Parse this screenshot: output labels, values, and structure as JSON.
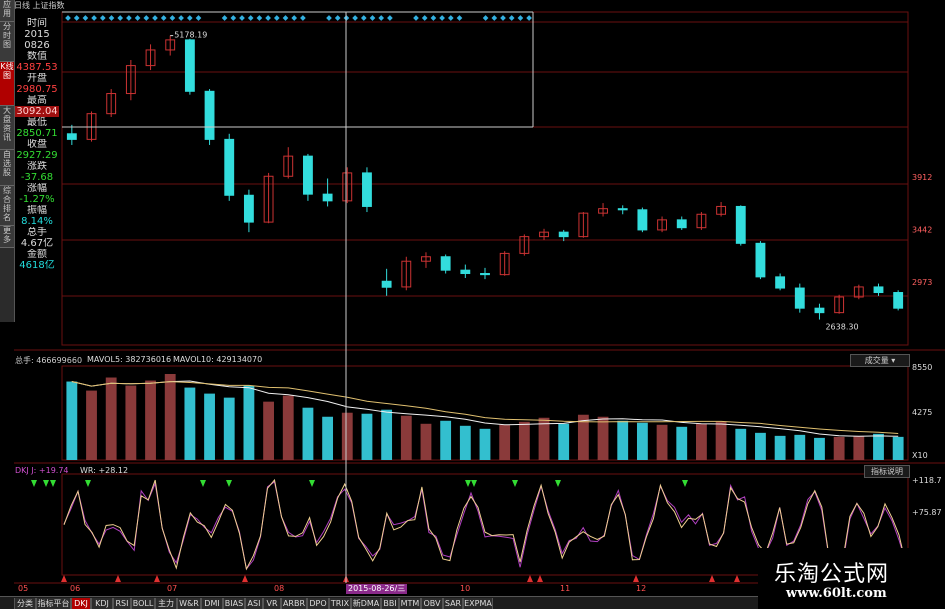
{
  "window": {
    "title": "日线  上证指数"
  },
  "left_nav": [
    {
      "label": "应用"
    },
    {
      "label": "分时图"
    },
    {
      "label": "K线图",
      "active": true
    },
    {
      "label": "大盘资讯"
    },
    {
      "label": "自选股"
    },
    {
      "label": "综合排名"
    },
    {
      "label": "更多"
    }
  ],
  "info_panel": {
    "time_label": "时间",
    "year": "2015",
    "date": "0826",
    "value_label": "数值",
    "value": "4387.53",
    "open_label": "开盘",
    "open": "2980.75",
    "high_label": "最高",
    "high": "3092.04",
    "low_label": "最低",
    "low": "2850.71",
    "close_label": "收盘",
    "close": "2927.29",
    "change_label": "涨跌",
    "change": "-37.68",
    "pct_label": "涨幅",
    "pct": "-1.27%",
    "amp_label": "振幅",
    "amp": "8.14%",
    "vol_label": "总手",
    "vol": "4.67亿",
    "amt_label": "金额",
    "amt": "4618亿"
  },
  "price_chart": {
    "high_marker": "5178.19",
    "low_marker": "2638.30",
    "y_ticks": [
      "3912",
      "3442",
      "2973"
    ]
  },
  "volume_panel": {
    "total_label": "总手: 466699660",
    "mavol5_label": "MAVOL5: 382736016",
    "mavol10_label": "MAVOL10: 429134070",
    "select_label": "成交量",
    "y_ticks": [
      "8550",
      "4275",
      "X10"
    ]
  },
  "indicator_panel": {
    "dkj_label": "DKJ J: +19.74",
    "wr_label": "WR: +28.12",
    "help_label": "指标说明",
    "y_ticks": [
      "+118.7",
      "+75.87"
    ]
  },
  "x_axis": {
    "labels": [
      "05",
      "06",
      "07",
      "08",
      "10",
      "11",
      "12"
    ],
    "crosshair_date": "2015-08-26/三"
  },
  "bottom_tabs": [
    "分类",
    "指标平台",
    "DKJ",
    "KDJ",
    "RSI",
    "BOLL",
    "主力",
    "W&R",
    "DMI",
    "BIAS",
    "ASI",
    "VR",
    "ARBR",
    "DPO",
    "TRIX",
    "新DMA",
    "BBI",
    "MTM",
    "OBV",
    "SAR",
    "EXPMA"
  ],
  "active_tab": "DKJ",
  "watermark": {
    "brand": "乐淘公式网",
    "url": "www.60lt.com"
  },
  "colors": {
    "up": "#cc3333",
    "down": "#33dddd",
    "grid": "#6a1010",
    "accent": "#b00000"
  },
  "chart_data": {
    "type": "candlestick",
    "title": "上证指数",
    "candles": [
      {
        "date": "2015-05-06",
        "open": 4300,
        "high": 4380,
        "low": 4200,
        "close": 4250
      },
      {
        "date": "2015-05-13",
        "open": 4250,
        "high": 4500,
        "low": 4230,
        "close": 4480
      },
      {
        "date": "2015-05-20",
        "open": 4480,
        "high": 4700,
        "low": 4450,
        "close": 4660
      },
      {
        "date": "2015-05-27",
        "open": 4660,
        "high": 4960,
        "low": 4600,
        "close": 4910
      },
      {
        "date": "2015-06-03",
        "open": 4910,
        "high": 5100,
        "low": 4870,
        "close": 5050
      },
      {
        "date": "2015-06-12",
        "open": 5050,
        "high": 5178.19,
        "low": 5000,
        "close": 5140
      },
      {
        "date": "2015-06-19",
        "open": 5140,
        "high": 5150,
        "low": 4650,
        "close": 4680
      },
      {
        "date": "2015-06-26",
        "open": 4680,
        "high": 4700,
        "low": 4200,
        "close": 4250
      },
      {
        "date": "2015-07-03",
        "open": 4250,
        "high": 4300,
        "low": 3700,
        "close": 3750
      },
      {
        "date": "2015-07-08",
        "open": 3750,
        "high": 3800,
        "low": 3420,
        "close": 3510
      },
      {
        "date": "2015-07-15",
        "open": 3510,
        "high": 3950,
        "low": 3500,
        "close": 3920
      },
      {
        "date": "2015-07-22",
        "open": 3920,
        "high": 4180,
        "low": 3900,
        "close": 4100
      },
      {
        "date": "2015-07-29",
        "open": 4100,
        "high": 4120,
        "low": 3700,
        "close": 3760
      },
      {
        "date": "2015-08-05",
        "open": 3760,
        "high": 3900,
        "low": 3650,
        "close": 3700
      },
      {
        "date": "2015-08-12",
        "open": 3700,
        "high": 4000,
        "low": 3680,
        "close": 3950
      },
      {
        "date": "2015-08-19",
        "open": 3950,
        "high": 4000,
        "low": 3600,
        "close": 3650
      },
      {
        "date": "2015-08-26",
        "open": 2980.75,
        "high": 3092.04,
        "low": 2850.71,
        "close": 2927.29
      },
      {
        "date": "2015-09-02",
        "open": 2930,
        "high": 3200,
        "low": 2900,
        "close": 3160
      },
      {
        "date": "2015-09-09",
        "open": 3160,
        "high": 3240,
        "low": 3100,
        "close": 3200
      },
      {
        "date": "2015-09-16",
        "open": 3200,
        "high": 3220,
        "low": 3050,
        "close": 3080
      },
      {
        "date": "2015-09-23",
        "open": 3080,
        "high": 3130,
        "low": 3010,
        "close": 3050
      },
      {
        "date": "2015-09-30",
        "open": 3050,
        "high": 3100,
        "low": 3000,
        "close": 3040
      },
      {
        "date": "2015-10-09",
        "open": 3040,
        "high": 3250,
        "low": 3030,
        "close": 3230
      },
      {
        "date": "2015-10-16",
        "open": 3230,
        "high": 3400,
        "low": 3210,
        "close": 3380
      },
      {
        "date": "2015-10-23",
        "open": 3380,
        "high": 3450,
        "low": 3350,
        "close": 3420
      },
      {
        "date": "2015-10-30",
        "open": 3420,
        "high": 3440,
        "low": 3340,
        "close": 3380
      },
      {
        "date": "2015-11-06",
        "open": 3380,
        "high": 3600,
        "low": 3370,
        "close": 3590
      },
      {
        "date": "2015-11-13",
        "open": 3590,
        "high": 3680,
        "low": 3560,
        "close": 3630
      },
      {
        "date": "2015-11-20",
        "open": 3630,
        "high": 3660,
        "low": 3580,
        "close": 3620
      },
      {
        "date": "2015-11-27",
        "open": 3620,
        "high": 3640,
        "low": 3420,
        "close": 3440
      },
      {
        "date": "2015-12-04",
        "open": 3440,
        "high": 3560,
        "low": 3420,
        "close": 3530
      },
      {
        "date": "2015-12-11",
        "open": 3530,
        "high": 3560,
        "low": 3440,
        "close": 3460
      },
      {
        "date": "2015-12-18",
        "open": 3460,
        "high": 3600,
        "low": 3440,
        "close": 3580
      },
      {
        "date": "2015-12-25",
        "open": 3580,
        "high": 3690,
        "low": 3560,
        "close": 3650
      },
      {
        "date": "2016-01-04",
        "open": 3650,
        "high": 3660,
        "low": 3300,
        "close": 3320
      },
      {
        "date": "2016-01-11",
        "open": 3320,
        "high": 3340,
        "low": 3000,
        "close": 3020
      },
      {
        "date": "2016-01-18",
        "open": 3020,
        "high": 3050,
        "low": 2900,
        "close": 2920
      },
      {
        "date": "2016-01-25",
        "open": 2920,
        "high": 2960,
        "low": 2700,
        "close": 2740
      },
      {
        "date": "2016-02-01",
        "open": 2740,
        "high": 2780,
        "low": 2638.3,
        "close": 2700
      },
      {
        "date": "2016-02-15",
        "open": 2700,
        "high": 2860,
        "low": 2690,
        "close": 2840
      },
      {
        "date": "2016-02-22",
        "open": 2840,
        "high": 2950,
        "low": 2820,
        "close": 2930
      },
      {
        "date": "2016-02-29",
        "open": 2930,
        "high": 2960,
        "low": 2850,
        "close": 2880
      },
      {
        "date": "2016-03-07",
        "open": 2880,
        "high": 2900,
        "low": 2720,
        "close": 2740
      }
    ],
    "volume": [
      7800,
      6900,
      8200,
      7400,
      7900,
      8550,
      7200,
      6600,
      6200,
      7400,
      5800,
      6400,
      5200,
      4300,
      4700,
      4600,
      5000,
      4400,
      3600,
      3900,
      3400,
      3100,
      3500,
      3800,
      4200,
      3600,
      4500,
      4300,
      3900,
      3700,
      3500,
      3300,
      3600,
      3800,
      3100,
      2700,
      2400,
      2500,
      2200,
      2300,
      2400,
      2600,
      2300
    ],
    "ylim": [
      2500,
      5300
    ]
  }
}
